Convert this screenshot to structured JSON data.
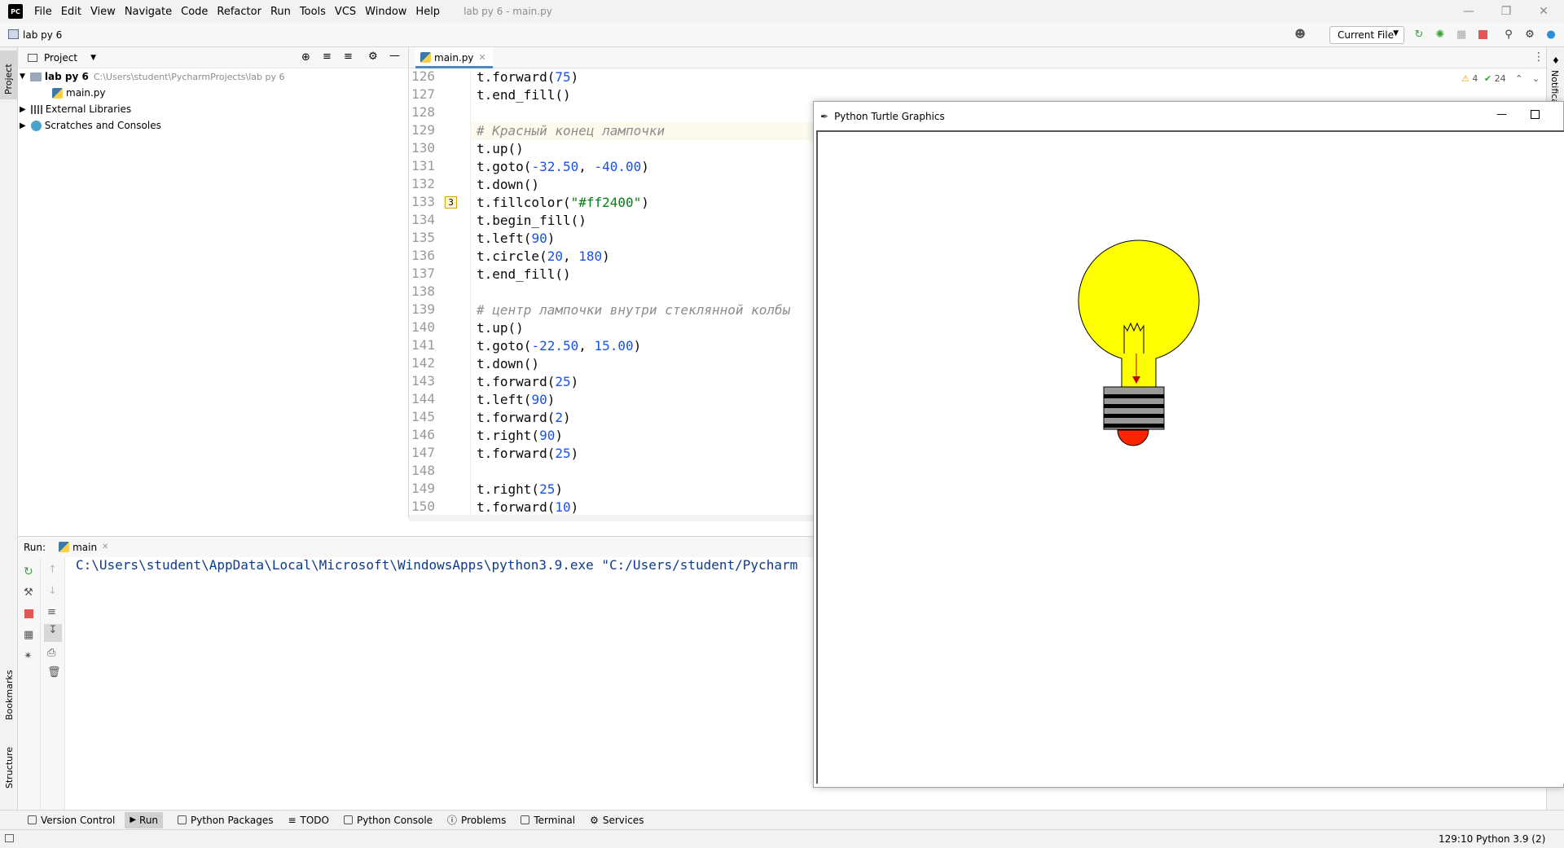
{
  "app": {
    "logo_text": "PC",
    "window_title": "lab py 6 - main.py",
    "menu": [
      "File",
      "Edit",
      "View",
      "Navigate",
      "Code",
      "Refactor",
      "Run",
      "Tools",
      "VCS",
      "Window",
      "Help"
    ]
  },
  "navbar": {
    "project": "lab py 6",
    "run_config": "Current File"
  },
  "project_panel": {
    "title": "Project",
    "tree": [
      {
        "label": "lab py 6",
        "hint": "C:\\Users\\student\\PycharmProjects\\lab py 6"
      },
      {
        "label": "main.py"
      },
      {
        "label": "External Libraries"
      },
      {
        "label": "Scratches and Consoles"
      }
    ]
  },
  "editor": {
    "tab": "main.py",
    "inspection": {
      "warnings": "4",
      "ok": "24"
    },
    "gutter_badge": "3",
    "lines": [
      {
        "n": "126",
        "html": "t.forward(<span class='num'>75</span>)"
      },
      {
        "n": "127",
        "html": "t.end_fill()"
      },
      {
        "n": "128",
        "html": ""
      },
      {
        "n": "129",
        "html": "<span class='cmt'># Красный конец лампочки</span>"
      },
      {
        "n": "130",
        "html": "t.up()"
      },
      {
        "n": "131",
        "html": "t.goto(<span class='num'>-32.50</span>, <span class='num'>-40.00</span>)"
      },
      {
        "n": "132",
        "html": "t.down()"
      },
      {
        "n": "133",
        "html": "t.fillcolor(<span class='str'>\"#ff2400\"</span>)"
      },
      {
        "n": "134",
        "html": "t.begin_fill()"
      },
      {
        "n": "135",
        "html": "t.left(<span class='num'>90</span>)"
      },
      {
        "n": "136",
        "html": "t.circle(<span class='num'>20</span>, <span class='num'>180</span>)"
      },
      {
        "n": "137",
        "html": "t.end_fill()"
      },
      {
        "n": "138",
        "html": ""
      },
      {
        "n": "139",
        "html": "<span class='cmt'># центр лампочки внутри стеклянной колбы</span>"
      },
      {
        "n": "140",
        "html": "t.up()"
      },
      {
        "n": "141",
        "html": "t.goto(<span class='num'>-22.50</span>, <span class='num'>15.00</span>)"
      },
      {
        "n": "142",
        "html": "t.down()"
      },
      {
        "n": "143",
        "html": "t.forward(<span class='num'>25</span>)"
      },
      {
        "n": "144",
        "html": "t.left(<span class='num'>90</span>)"
      },
      {
        "n": "145",
        "html": "t.forward(<span class='num'>2</span>)"
      },
      {
        "n": "146",
        "html": "t.right(<span class='num'>90</span>)"
      },
      {
        "n": "147",
        "html": "t.forward(<span class='num'>25</span>)"
      },
      {
        "n": "148",
        "html": ""
      },
      {
        "n": "149",
        "html": "t.right(<span class='num'>25</span>)"
      },
      {
        "n": "150",
        "html": "t.forward(<span class='num'>10</span>)"
      }
    ]
  },
  "run_panel": {
    "label": "Run:",
    "tab": "main",
    "console": "C:\\Users\\student\\AppData\\Local\\Microsoft\\WindowsApps\\python3.9.exe \"C:/Users/student/Pycharm"
  },
  "left_stripe": {
    "project": "Project",
    "bookmarks": "Bookmarks",
    "structure": "Structure"
  },
  "right_stripe": {
    "notifications": "Notifications"
  },
  "bottom_tools": [
    "Version Control",
    "Run",
    "Python Packages",
    "TODO",
    "Python Console",
    "Problems",
    "Terminal",
    "Services"
  ],
  "statusbar": {
    "position": "129:10",
    "interpreter": "Python 3.9 (2)"
  },
  "turtle": {
    "title": "Python Turtle Graphics",
    "colors": {
      "bulb": "#ffff00",
      "tip": "#ff2400",
      "base_dark": "#000000",
      "base_light": "#9a9a9a"
    }
  }
}
